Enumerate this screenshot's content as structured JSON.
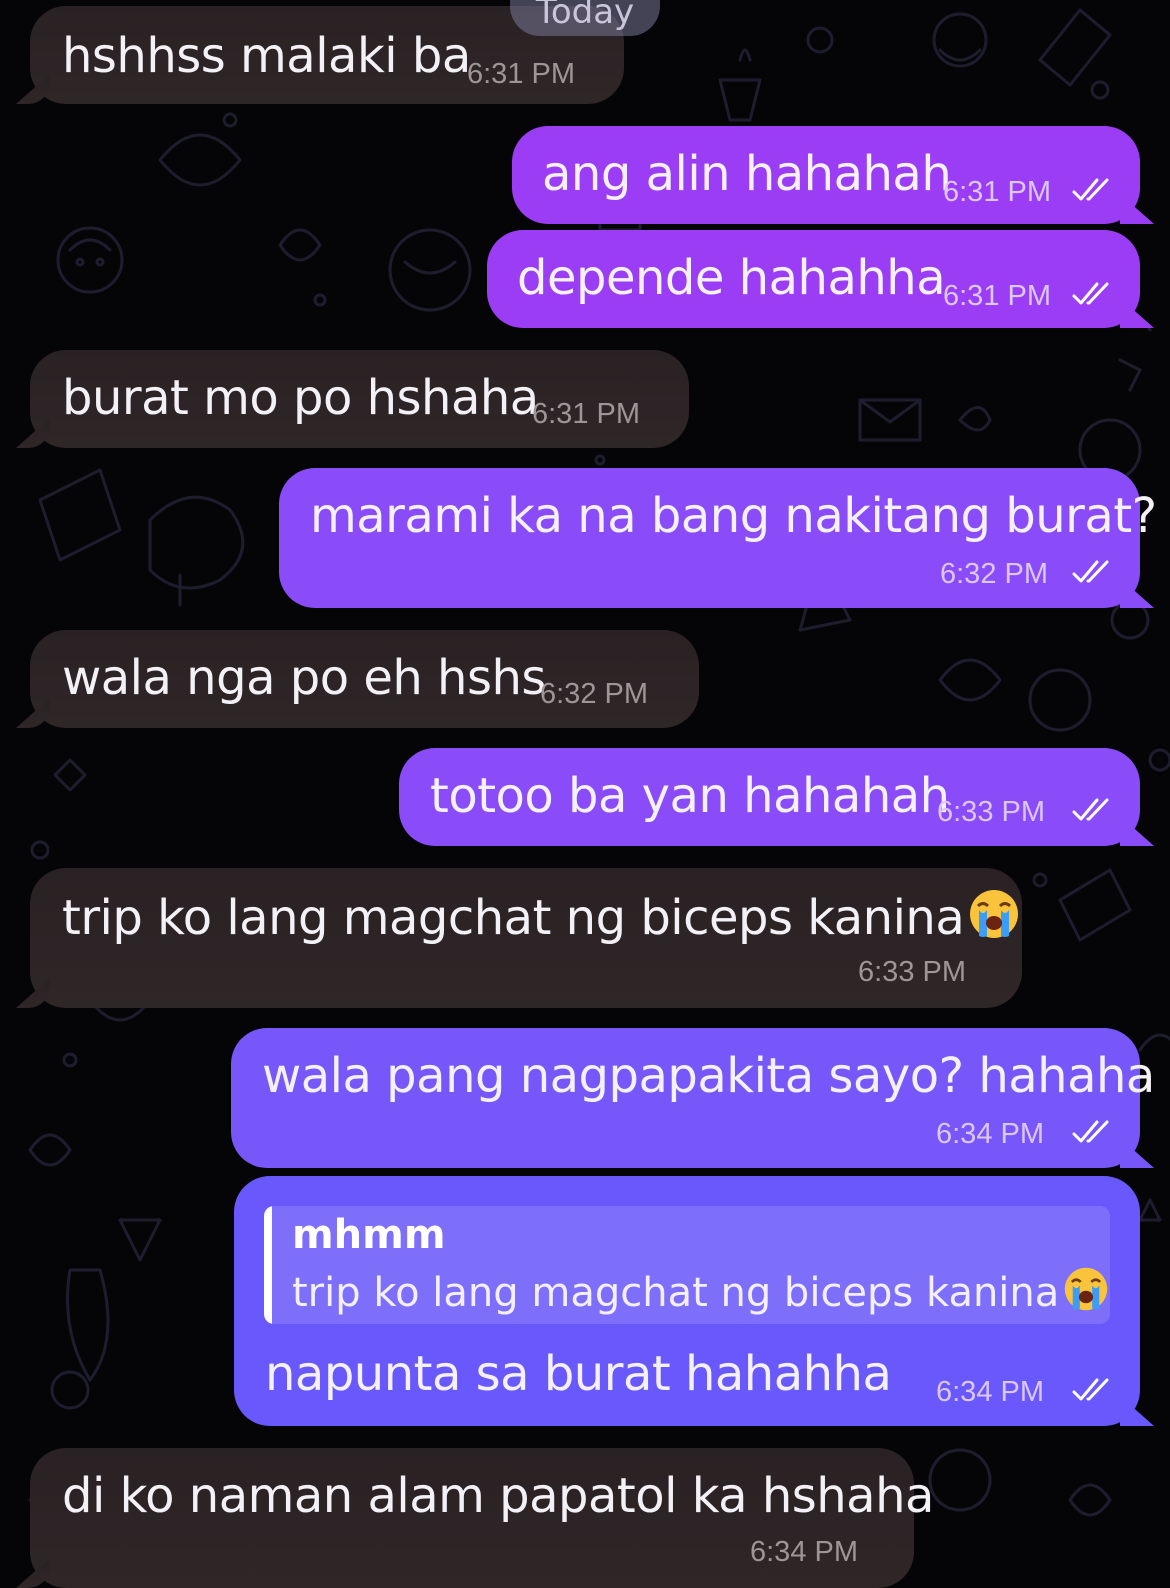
{
  "date_separator": "Today",
  "messages": [
    {
      "direction": "in",
      "text": "hshhss malaki ba",
      "time": "6:31 PM"
    },
    {
      "direction": "out",
      "text": "ang alin hahahah",
      "time": "6:31 PM",
      "status": "read"
    },
    {
      "direction": "out",
      "text": "depende hahahha",
      "time": "6:31 PM",
      "status": "read"
    },
    {
      "direction": "in",
      "text": "burat mo po hshaha",
      "time": "6:31 PM"
    },
    {
      "direction": "out",
      "text": "marami ka na bang nakitang burat?",
      "time": "6:32 PM",
      "status": "read"
    },
    {
      "direction": "in",
      "text": "wala nga po eh hshs",
      "time": "6:32 PM"
    },
    {
      "direction": "out",
      "text": "totoo ba yan hahahah",
      "time": "6:33 PM",
      "status": "read"
    },
    {
      "direction": "in",
      "text": "trip ko lang magchat ng biceps kanina",
      "emoji": "loudly-crying-face",
      "time": "6:33 PM"
    },
    {
      "direction": "out",
      "text": "wala pang nagpapakita sayo? hahaha",
      "time": "6:34 PM",
      "status": "read"
    },
    {
      "direction": "out",
      "reply_to": {
        "name": "mhmm",
        "text": "trip ko lang magchat ng biceps kanina",
        "emoji": "loudly-crying-face"
      },
      "text": "napunta sa burat hahahha",
      "time": "6:34 PM",
      "status": "read"
    },
    {
      "direction": "in",
      "text": "di ko naman alam papatol ka hshaha",
      "time": "6:34 PM"
    }
  ],
  "colors": {
    "background": "#050507",
    "incoming_bubble": "#2a2124",
    "outgoing_bubble_top": "#9b3df5",
    "outgoing_bubble_bottom": "#6958fb",
    "doodle_stroke": "#1c1b2a"
  }
}
